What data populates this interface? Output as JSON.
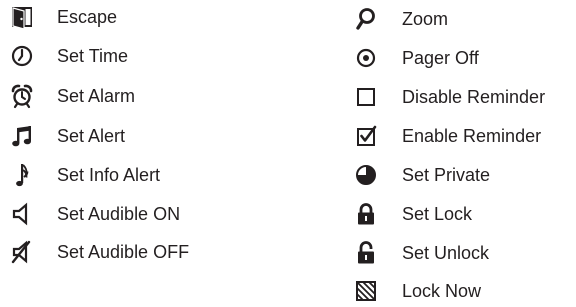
{
  "legend": {
    "left": [
      {
        "icon": "escape-door-icon",
        "label": "Escape"
      },
      {
        "icon": "clock-icon",
        "label": "Set Time"
      },
      {
        "icon": "alarm-clock-icon",
        "label": "Set Alarm"
      },
      {
        "icon": "double-music-note-icon",
        "label": "Set Alert"
      },
      {
        "icon": "single-music-note-icon",
        "label": "Set Info Alert"
      },
      {
        "icon": "speaker-icon",
        "label": "Set Audible ON"
      },
      {
        "icon": "speaker-muted-icon",
        "label": "Set Audible OFF"
      }
    ],
    "right": [
      {
        "icon": "magnifier-icon",
        "label": "Zoom"
      },
      {
        "icon": "target-dot-icon",
        "label": "Pager Off"
      },
      {
        "icon": "empty-checkbox-icon",
        "label": "Disable Reminder"
      },
      {
        "icon": "checked-checkbox-icon",
        "label": "Enable Reminder"
      },
      {
        "icon": "half-circle-icon",
        "label": "Set Private"
      },
      {
        "icon": "locked-padlock-icon",
        "label": "Set Lock"
      },
      {
        "icon": "unlocked-padlock-icon",
        "label": "Set Unlock"
      },
      {
        "icon": "hatched-square-icon",
        "label": "Lock Now"
      }
    ]
  }
}
